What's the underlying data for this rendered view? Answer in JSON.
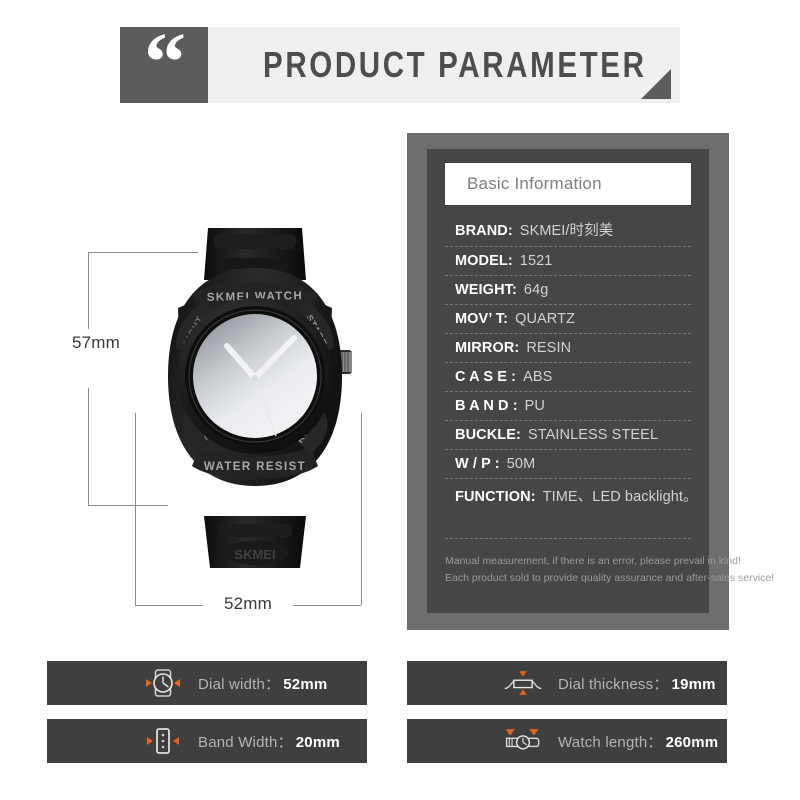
{
  "header": {
    "quote_glyph": "“",
    "title": "PRODUCT PARAMETER"
  },
  "dimensions": {
    "height_label": "57mm",
    "width_label": "52mm"
  },
  "watch": {
    "brand_text": "SKMEI WATCH",
    "button_start": "START",
    "button_reset": "RESET",
    "button_mode": "MODE",
    "button_light": "LIGHT",
    "water_resist": "WATER RESIST"
  },
  "spec": {
    "title": "Basic Information",
    "rows": [
      {
        "label": "BRAND:",
        "value": "SKMEI/时刻美"
      },
      {
        "label": "MODEL:",
        "value": "1521"
      },
      {
        "label": "WEIGHT:",
        "value": "64g"
      },
      {
        "label": "MOV’ T:",
        "value": "QUARTZ"
      },
      {
        "label": "MIRROR:",
        "value": "RESIN"
      },
      {
        "label": "C A S E :",
        "value": "ABS"
      },
      {
        "label": "B A N D :",
        "value": "PU"
      },
      {
        "label": "BUCKLE:",
        "value": "STAINLESS STEEL"
      },
      {
        "label": "W / P :",
        "value": "50M"
      },
      {
        "label": "FUNCTION:",
        "value": "TIME、LED backlight。"
      }
    ],
    "note_line_1": "Manual measurement, if there is an error, please prevail in kind!",
    "note_line_2": "Each product sold to provide quality assurance and after-sales service!"
  },
  "features": [
    {
      "icon": "dial-width-icon",
      "label": "Dial width：",
      "value": "52mm"
    },
    {
      "icon": "band-width-icon",
      "label": "Band Width：",
      "value": "20mm"
    },
    {
      "icon": "dial-thickness-icon",
      "label": "Dial thickness：",
      "value": "19mm"
    },
    {
      "icon": "watch-length-icon",
      "label": "Watch length：",
      "value": "260mm"
    }
  ],
  "colors": {
    "accent_orange": "#e8631f",
    "panel_dark": "#464646",
    "frame_gray": "#6e6e6e",
    "banner_light": "#efefef",
    "banner_dark": "#5c5c5c"
  }
}
